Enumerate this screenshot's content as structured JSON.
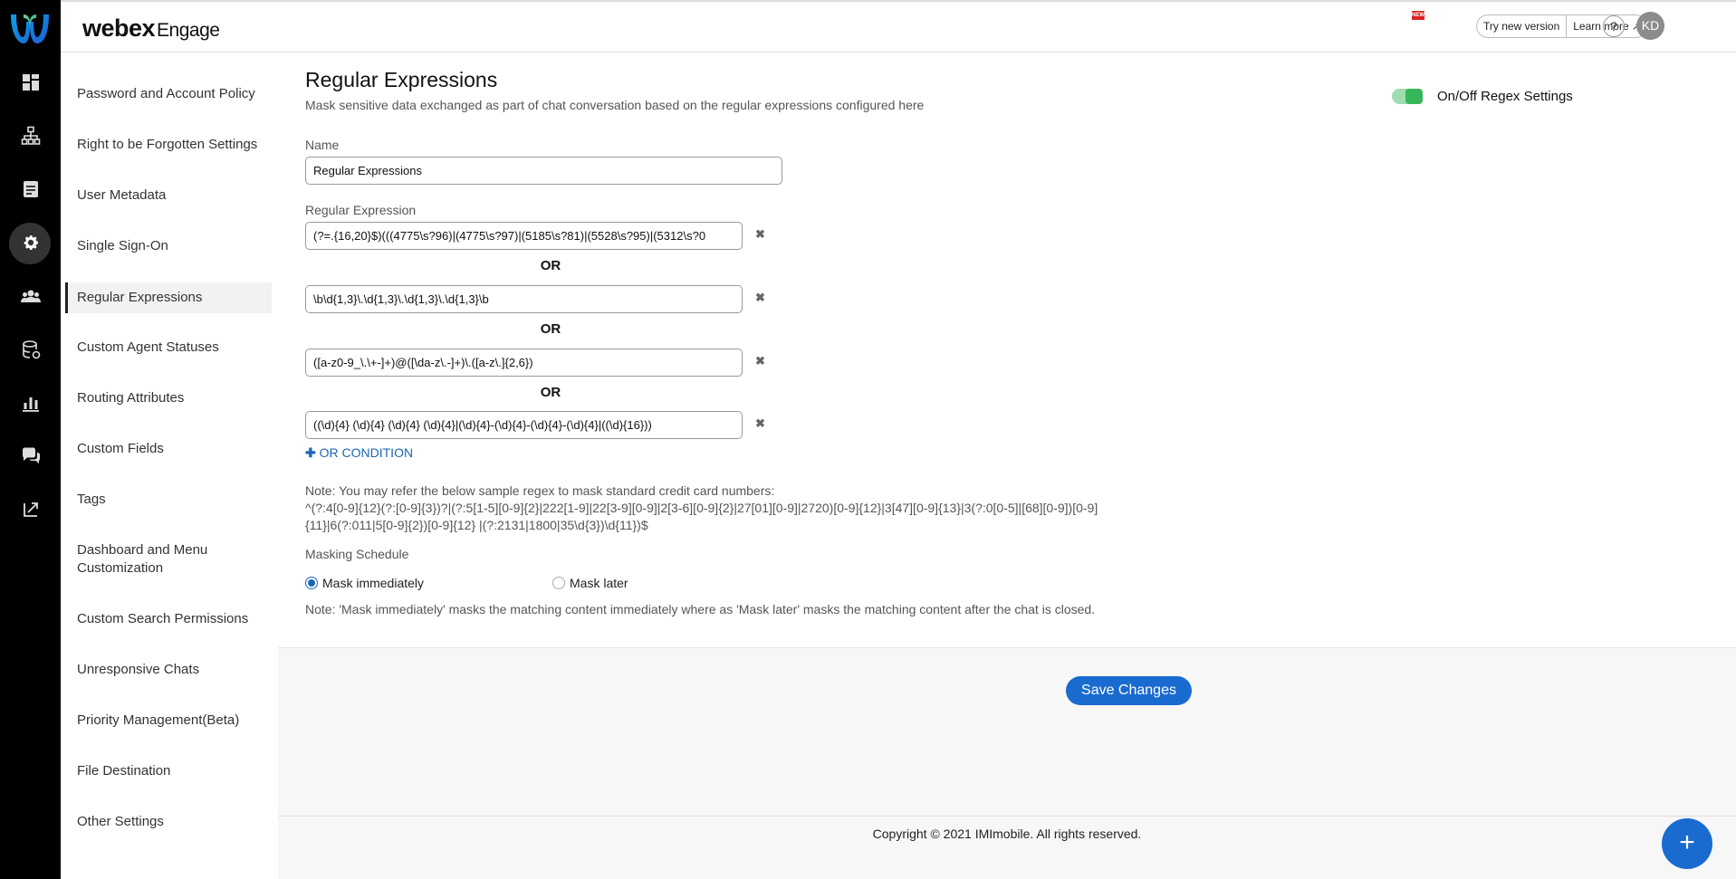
{
  "header": {
    "brand_bold": "webex",
    "brand_product": "Engage",
    "new_badge": "NEW",
    "try_new_version": "Try new version",
    "learn_more": "Learn more",
    "help": "?",
    "avatar_initials": "KD"
  },
  "rail": {
    "icons": [
      "dashboard-icon",
      "org-chart-icon",
      "document-icon",
      "settings-icon",
      "users-icon",
      "database-icon",
      "reports-icon",
      "chat-icon",
      "export-icon"
    ],
    "active": "settings-icon"
  },
  "subnav": {
    "items": [
      {
        "label": "Password and Account Policy"
      },
      {
        "label": "Right to be Forgotten Settings"
      },
      {
        "label": "User Metadata"
      },
      {
        "label": "Single Sign-On"
      },
      {
        "label": "Regular Expressions",
        "active": true
      },
      {
        "label": "Custom Agent Statuses"
      },
      {
        "label": "Routing Attributes"
      },
      {
        "label": "Custom Fields"
      },
      {
        "label": "Tags"
      },
      {
        "label": "Dashboard and Menu Customization"
      },
      {
        "label": "Custom Search Permissions"
      },
      {
        "label": "Unresponsive Chats"
      },
      {
        "label": "Priority Management(Beta)"
      },
      {
        "label": "File Destination"
      },
      {
        "label": "Other Settings"
      }
    ]
  },
  "main": {
    "title": "Regular Expressions",
    "subtitle": "Mask sensitive data exchanged as part of chat conversation based on the regular expressions configured here",
    "toggle_label": "On/Off Regex Settings",
    "toggle_on": true,
    "name_label": "Name",
    "name_value": "Regular Expressions",
    "regex_label": "Regular Expression",
    "regexes": [
      "(?=.{16,20}$)(((4775\\s?96)|(4775\\s?97)|(5185\\s?81)|(5528\\s?95)|(5312\\s?0",
      "\\b\\d{1,3}\\.\\d{1,3}\\.\\d{1,3}\\.\\d{1,3}\\b",
      "([a-z0-9_\\.\\+-]+)@([\\da-z\\.-]+)\\.([a-z\\.]{2,6})",
      "((\\d){4} (\\d){4} (\\d){4} (\\d){4}|(\\d){4}-(\\d){4}-(\\d){4}-(\\d){4}|((\\d){16}))"
    ],
    "or_text": "OR",
    "remove_glyph": "✖",
    "add_condition": "OR CONDITION",
    "note_title": "Note: You may refer the below sample regex to mask standard credit card numbers:",
    "note_regex_line1": "^(?:4[0-9]{12}(?:[0-9]{3})?|(?:5[1-5][0-9]{2}|222[1-9]|22[3-9][0-9]|2[3-6][0-9]{2}|27[01][0-9]|2720)[0-9]{12}|3[47][0-9]{13}|3(?:0[0-5]|[68][0-9])[0-9]",
    "note_regex_line2": "{11}|6(?:011|5[0-9]{2})[0-9]{12} |(?:2131|1800|35\\d{3})\\d{11})$",
    "masking_label": "Masking Schedule",
    "mask_immediately": "Mask immediately",
    "mask_later": "Mask later",
    "masking_selected": "Mask immediately",
    "masking_note": "Note: 'Mask immediately' masks the matching content immediately where as 'Mask later' masks the matching content after the chat is closed.",
    "save_label": "Save Changes"
  },
  "footer": {
    "copyright": "Copyright © 2021 IMImobile. All rights reserved.",
    "fab": "+"
  },
  "colors": {
    "accent": "#1a6bd0",
    "toggle_on": "#38b75a",
    "rail_bg": "#000000"
  }
}
